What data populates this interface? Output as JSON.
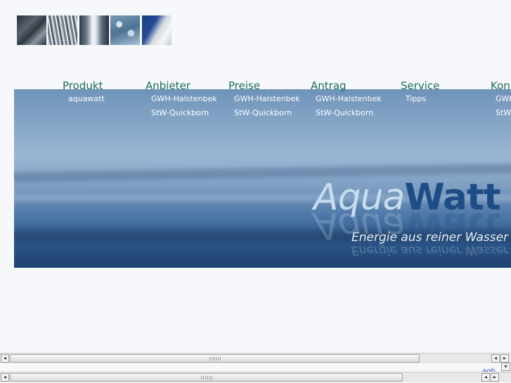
{
  "thumbnails": [
    "water-texture-thumb-1",
    "waterfall-thumb-2",
    "waterfall-thumb-3",
    "water-splash-thumb-4",
    "dam-thumb-5"
  ],
  "banner": {
    "logo_part1": "Aqua",
    "logo_part2": "Watt",
    "tagline": "Energie aus reiner Wasser"
  },
  "nav": [
    {
      "label": "Produkt",
      "items": [
        "aquawatt"
      ]
    },
    {
      "label": "Anbieter",
      "items": [
        "GWH-Halstenbek",
        "StW-Quickborn"
      ]
    },
    {
      "label": "Preise",
      "items": [
        "GWH-Halstenbek",
        "StW-Quickborn"
      ]
    },
    {
      "label": "Antrag",
      "items": [
        "GWH-Halstenbek",
        "StW-Quickborn"
      ]
    },
    {
      "label": "Service",
      "items": [
        "Tipps"
      ]
    },
    {
      "label": "Kon",
      "items": [
        "GWH",
        "StW-"
      ]
    }
  ],
  "scrollbar": {
    "left_arrow": "◂",
    "right_arrow": "▸",
    "down_arrow": "▾"
  },
  "peek_text": "agb"
}
